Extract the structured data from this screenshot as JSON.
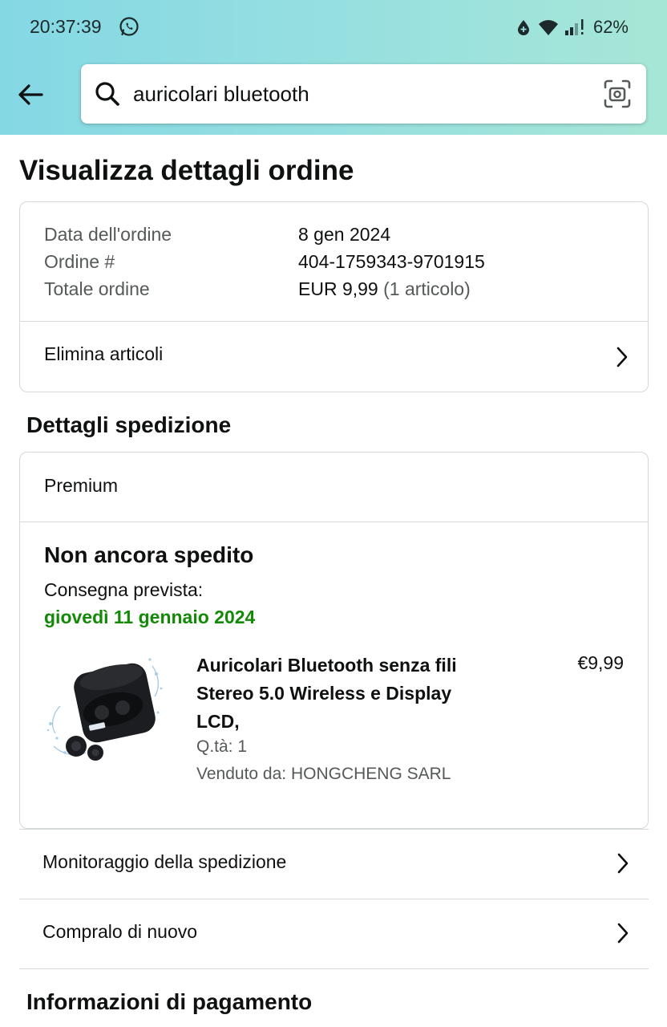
{
  "status_bar": {
    "time": "20:37:39",
    "battery": "62%"
  },
  "search": {
    "query": "auricolari bluetooth"
  },
  "page": {
    "title": "Visualizza dettagli ordine"
  },
  "order": {
    "date_label": "Data dell'ordine",
    "date_value": "8 gen 2024",
    "number_label": "Ordine #",
    "number_value": "404-1759343-9701915",
    "total_label": "Totale ordine",
    "total_value": "EUR 9,99",
    "total_items": "(1 articolo)",
    "delete_items": "Elimina articoli"
  },
  "shipping": {
    "section_title": "Dettagli spedizione",
    "method": "Premium",
    "status": "Non ancora spedito",
    "delivery_label": "Consegna prevista:",
    "delivery_date": "giovedì 11 gennaio 2024",
    "product": {
      "title": "Auricolari Bluetooth senza fili Stereo 5.0 Wireless e Display LCD,",
      "quantity": "Q.tà: 1",
      "seller": "Venduto da: HONGCHENG SARL",
      "price": "€9,99"
    }
  },
  "actions": {
    "track": "Monitoraggio della spedizione",
    "buy_again": "Compralo di nuovo"
  },
  "payment": {
    "section_title": "Informazioni di pagamento"
  },
  "colors": {
    "header_gradient_start": "#84d8e4",
    "header_gradient_end": "#a6e6d6",
    "delivery_green": "#138a07",
    "muted_text": "#565959",
    "border": "#d5d9d9"
  },
  "icons": [
    "whatsapp-icon",
    "data-saver-icon",
    "wifi-icon",
    "signal-icon",
    "back-arrow-icon",
    "search-icon",
    "camera-lens-icon",
    "chevron-right-icon"
  ]
}
